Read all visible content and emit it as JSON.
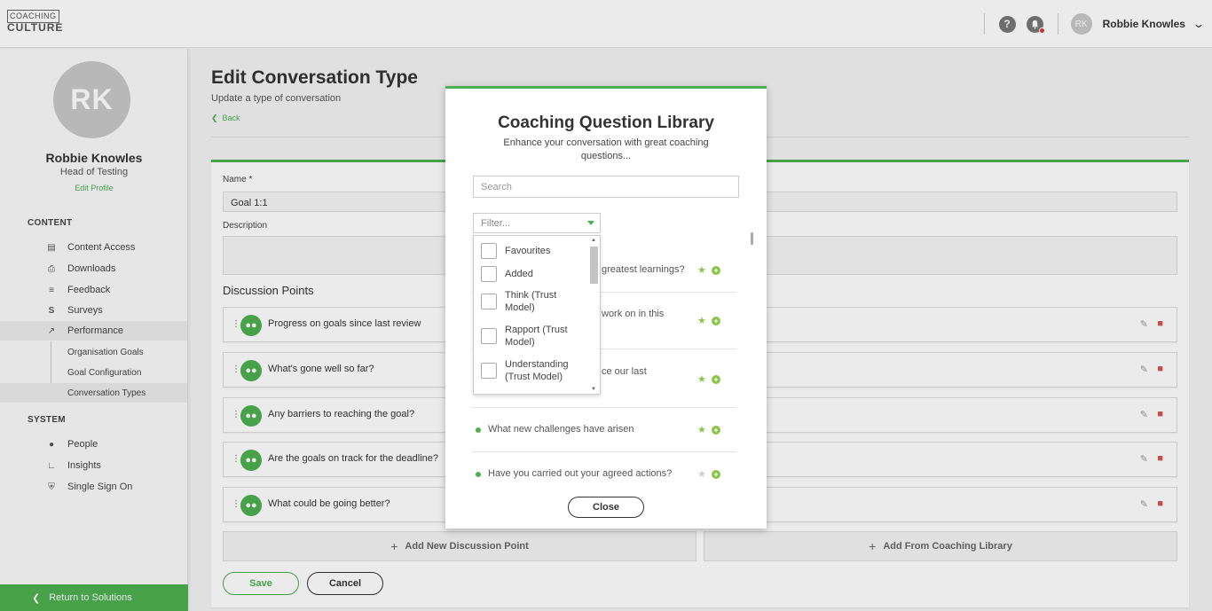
{
  "logo": {
    "line1": "COACHING",
    "line2": "CULTURE"
  },
  "topbar": {
    "help_icon": "?",
    "avatar_initials": "RK",
    "username": "Robbie Knowles"
  },
  "sidebar": {
    "avatar_initials": "RK",
    "name": "Robbie Knowles",
    "role": "Head of Testing",
    "edit_profile": "Edit Profile",
    "content_heading": "CONTENT",
    "content_items": [
      "Content Access",
      "Downloads",
      "Feedback",
      "Surveys",
      "Performance"
    ],
    "performance_sub": [
      "Organisation Goals",
      "Goal Configuration",
      "Conversation Types"
    ],
    "system_heading": "SYSTEM",
    "system_items": [
      "People",
      "Insights",
      "Single Sign On"
    ],
    "return_label": "Return to Solutions"
  },
  "main": {
    "title": "Edit Conversation Type",
    "subtitle": "Update a type of conversation",
    "back": "Back",
    "name_label": "Name *",
    "name_value": "Goal 1:1",
    "description_label": "Description",
    "description_value": "",
    "discussion_heading": "Discussion Points",
    "discussion_points": [
      "Progress on goals since last review",
      "What's gone well so far?",
      "Any barriers to reaching the goal?",
      "Are the goals on track for the deadline?",
      "What could be going better?"
    ],
    "add_new_label": "Add New Discussion Point",
    "add_library_label": "Add From Coaching Library",
    "save_label": "Save",
    "cancel_label": "Cancel"
  },
  "modal": {
    "title": "Coaching Question Library",
    "subtitle": "Enhance your conversation with great coaching questions...",
    "search_placeholder": "Search",
    "filter_placeholder": "Filter...",
    "questions": [
      {
        "text": "greatest learnings?",
        "favourite": true
      },
      {
        "text": "work on in this",
        "favourite": true
      },
      {
        "text": "ce our last",
        "favourite": true
      },
      {
        "text": "What new challenges have arisen",
        "favourite": true
      },
      {
        "text": "Have you carried out your agreed actions?",
        "favourite": false
      }
    ],
    "close_label": "Close"
  },
  "filter_dropdown": {
    "options": [
      "Favourites",
      "Added",
      "Think (Trust Model)",
      "Rapport (Trust Model)",
      "Understanding (Trust Model)"
    ]
  },
  "colors": {
    "accent": "#4caf50",
    "danger": "#d9534f"
  }
}
